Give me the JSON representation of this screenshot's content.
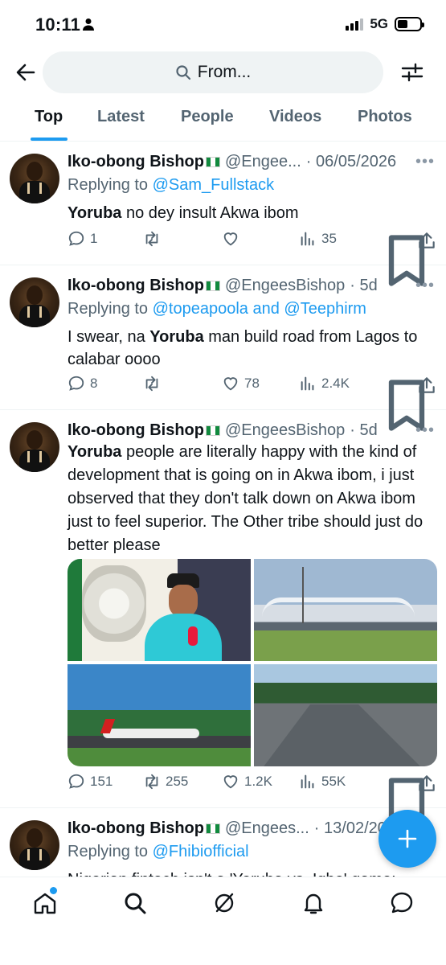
{
  "status_bar": {
    "time": "10:11",
    "network": "5G"
  },
  "search": {
    "placeholder": "From..."
  },
  "tabs": [
    {
      "label": "Top"
    },
    {
      "label": "Latest"
    },
    {
      "label": "People"
    },
    {
      "label": "Videos"
    },
    {
      "label": "Photos"
    }
  ],
  "tweets": [
    {
      "name": "Iko-obong Bishop",
      "handle": "@Engee...",
      "date": "· 06/05/2026",
      "reply_prefix": "Replying to ",
      "reply_to": "@Sam_Fullstack",
      "text_bold": "Yoruba",
      "text_rest": " no dey insult Akwa ibom",
      "replies": "1",
      "retweets": "",
      "likes": "",
      "views": "35"
    },
    {
      "name": "Iko-obong Bishop",
      "handle": "@EngeesBishop",
      "date": "· 5d",
      "reply_prefix": "Replying to ",
      "reply_to": "@topeapoola and @Teephirm",
      "text_pre": "I swear,  na ",
      "text_bold": "Yoruba",
      "text_rest": " man build road from Lagos to calabar oooo",
      "replies": "8",
      "retweets": "",
      "likes": "78",
      "views": "2.4K"
    },
    {
      "name": "Iko-obong Bishop",
      "handle": "@EngeesBishop",
      "date": "· 5d",
      "text_bold": "Yoruba",
      "text_rest": " people are literally happy with the kind of development that is going on in Akwa ibom, i just observed that they don't talk down on Akwa ibom just to feel superior. The Other tribe should just do better please",
      "replies": "151",
      "retweets": "255",
      "likes": "1.2K",
      "views": "55K"
    },
    {
      "name": "Iko-obong Bishop",
      "handle": "@Engees...",
      "date": "· 13/02/20",
      "reply_prefix": "Replying to ",
      "reply_to": "@Fhibiofficial",
      "text_peek": "Nigerian fintech isn't a 'Yoruba vs. Igbo' game:"
    }
  ],
  "colors": {
    "accent": "#1d9bf0",
    "muted": "#536471",
    "text": "#0f1419"
  }
}
